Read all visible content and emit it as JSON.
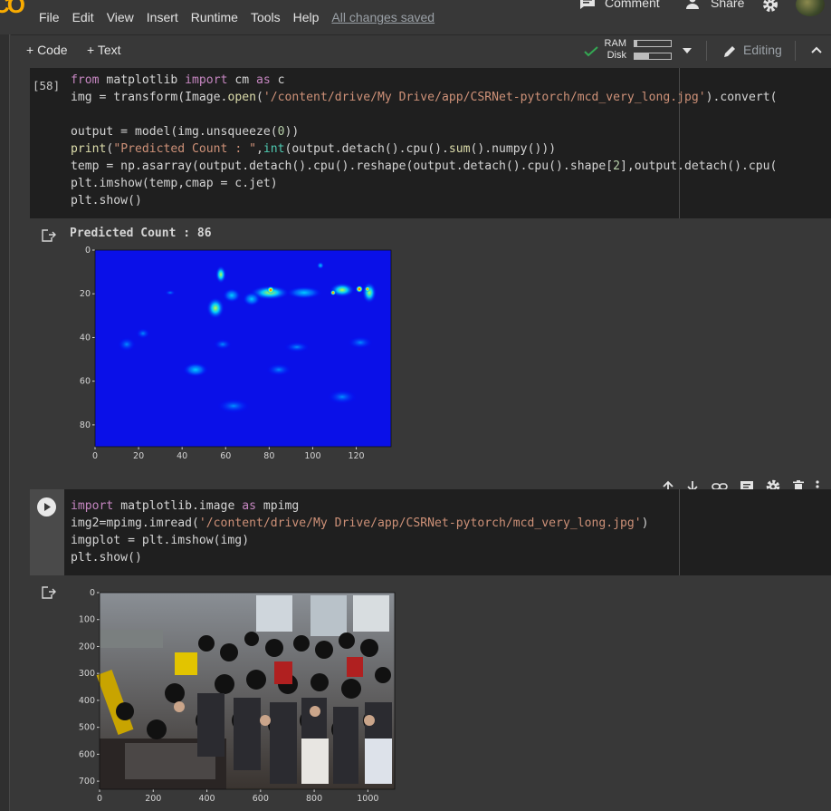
{
  "app": {
    "logo_text": "CO"
  },
  "menu": [
    "File",
    "Edit",
    "View",
    "Insert",
    "Runtime",
    "Tools",
    "Help"
  ],
  "saved_status": "All changes saved",
  "header_actions": {
    "comment": "Comment",
    "share": "Share"
  },
  "toolbar": {
    "add_code": "+ Code",
    "add_text": "+ Text",
    "ram_label": "RAM",
    "disk_label": "Disk",
    "ram_fill": 0.08,
    "disk_fill": 0.4,
    "editing": "Editing"
  },
  "cell1": {
    "exec_count": "[58]",
    "output_text": "Predicted Count :  86",
    "heatmap": {
      "x_ticks": [
        "0",
        "20",
        "40",
        "60",
        "80",
        "100",
        "120"
      ],
      "y_ticks": [
        "0",
        "20",
        "40",
        "60",
        "80"
      ],
      "x_range": [
        0,
        136
      ],
      "y_range": [
        0,
        90
      ],
      "colormap": "jet"
    }
  },
  "cell2": {
    "photo": {
      "x_ticks": [
        "0",
        "200",
        "400",
        "600",
        "800",
        "1000"
      ],
      "y_ticks": [
        "0",
        "100",
        "200",
        "300",
        "400",
        "500",
        "600",
        "700"
      ],
      "x_range": [
        0,
        1100
      ],
      "y_range": [
        0,
        730
      ]
    }
  },
  "colors": {
    "accent": "#f9ab00",
    "bg": "#383838",
    "cell_bg": "#1f1f1f",
    "keyword": "#c586c0",
    "string": "#ce9178"
  }
}
